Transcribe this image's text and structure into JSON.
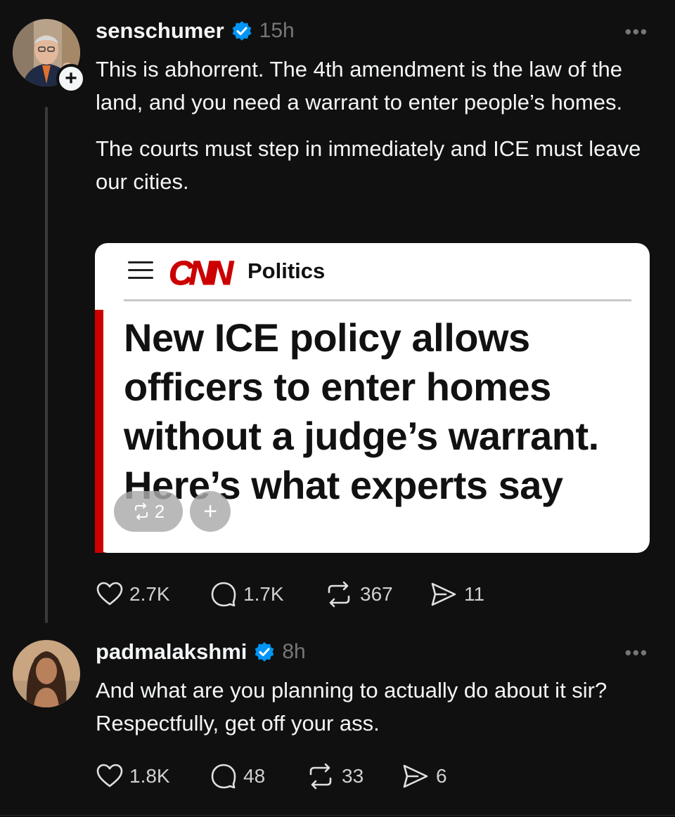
{
  "posts": [
    {
      "username": "senschumer",
      "time": "15h",
      "paragraphs": [
        "This is abhorrent. The 4th amendment is the law of the land, and you need a warrant to enter people’s homes.",
        "The courts must step in immediately and ICE must leave our cities."
      ],
      "card": {
        "brand": "CNN",
        "section": "Politics",
        "headline": "New ICE policy allows officers to enter homes without a judge’s warrant. Here’s what experts say",
        "repost_count": "2"
      },
      "stats": {
        "likes": "2.7K",
        "replies": "1.7K",
        "reposts": "367",
        "shares": "11"
      }
    },
    {
      "username": "padmalakshmi",
      "time": "8h",
      "paragraphs": [
        "And what are you planning to actually do about it sir? Respectfully, get off your ass."
      ],
      "stats": {
        "likes": "1.8K",
        "replies": "48",
        "reposts": "33",
        "shares": "6"
      }
    }
  ],
  "colors": {
    "background": "#101010",
    "verified": "#0095f6",
    "cnn_red": "#cc0000",
    "muted": "#777777"
  },
  "icons": [
    "follow-plus-icon",
    "verified-badge-icon",
    "more-icon",
    "heart-icon",
    "reply-icon",
    "repost-icon",
    "share-icon"
  ]
}
